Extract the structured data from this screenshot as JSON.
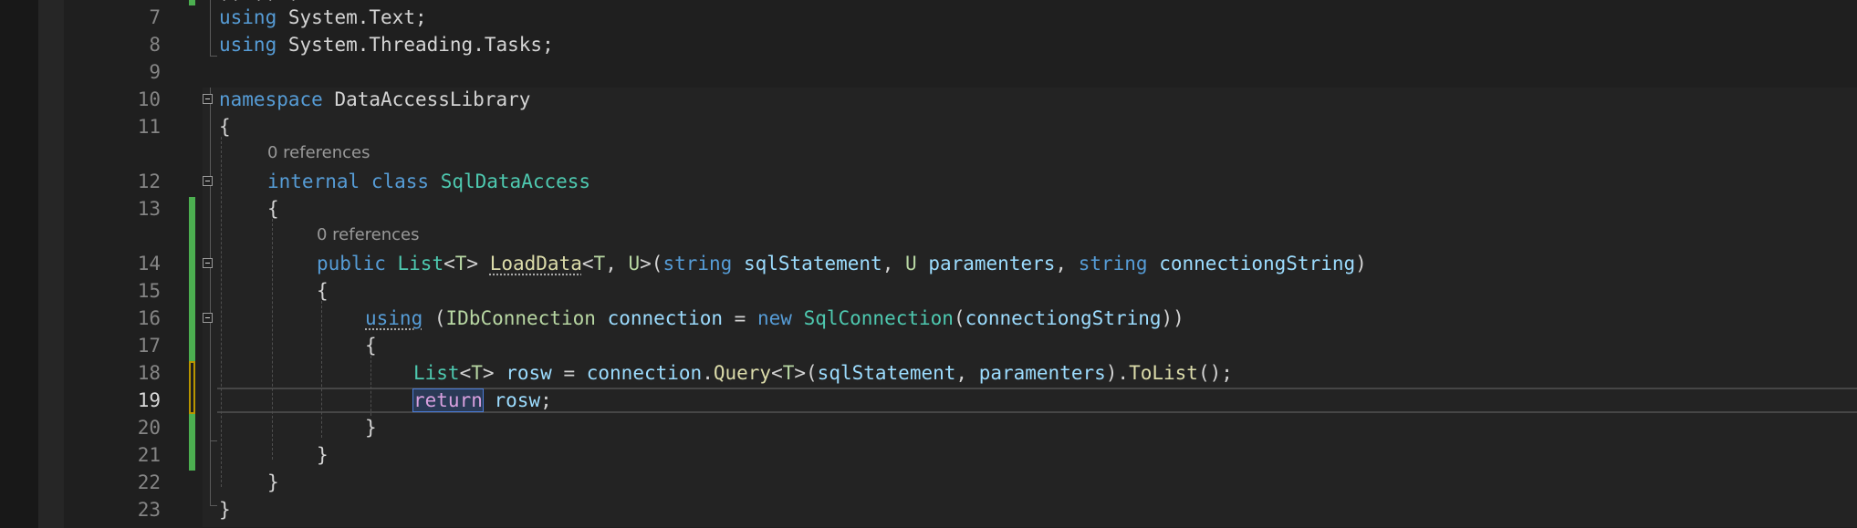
{
  "editor": {
    "lines": [
      {
        "num": "7",
        "tokens": [
          "using",
          "System",
          ".",
          "Text",
          ";"
        ]
      },
      {
        "num": "8",
        "tokens": [
          "using",
          "System",
          ".",
          "Threading",
          ".",
          "Tasks",
          ";"
        ]
      },
      {
        "num": "9",
        "tokens": []
      },
      {
        "num": "10",
        "tokens": [
          "namespace",
          "DataAccessLibrary"
        ]
      },
      {
        "num": "11",
        "tokens": [
          "{"
        ]
      },
      {
        "num": "12",
        "codelens": "0 references",
        "tokens": [
          "internal",
          "class",
          "SqlDataAccess"
        ]
      },
      {
        "num": "13",
        "tokens": [
          "{"
        ]
      },
      {
        "num": "14",
        "codelens": "0 references",
        "tokens": [
          "public",
          "List",
          "<",
          "T",
          ">",
          "LoadData",
          "<",
          "T",
          ",",
          "U",
          ">(",
          "string",
          "sqlStatement",
          ",",
          "U",
          "paramenters",
          ",",
          "string",
          "connectiongString",
          ")"
        ]
      },
      {
        "num": "15",
        "tokens": [
          "{"
        ]
      },
      {
        "num": "16",
        "tokens": [
          "using",
          "(",
          "IDbConnection",
          "connection",
          "=",
          "new",
          "SqlConnection",
          "(",
          "connectiongString",
          "))"
        ]
      },
      {
        "num": "17",
        "tokens": [
          "{"
        ]
      },
      {
        "num": "18",
        "tokens": [
          "List",
          "<",
          "T",
          ">",
          "rosw",
          "=",
          "connection",
          ".",
          "Query",
          "<",
          "T",
          ">(",
          "sqlStatement",
          ",",
          "paramenters",
          ").",
          "ToList",
          "();"
        ]
      },
      {
        "num": "19",
        "tokens": [
          "return",
          "rosw",
          ";"
        ]
      },
      {
        "num": "20",
        "tokens": [
          "}"
        ]
      },
      {
        "num": "21",
        "tokens": [
          "}"
        ]
      },
      {
        "num": "22",
        "tokens": [
          "}"
        ]
      },
      {
        "num": "23",
        "tokens": [
          "}"
        ]
      }
    ],
    "active_line": "19",
    "colors": {
      "keyword": "#569cd6",
      "control_keyword": "#d8a0df",
      "type": "#4ec9b0",
      "type_param": "#b8d7a3",
      "method": "#dcdcaa",
      "variable": "#9cdcfe",
      "text": "#d4d4d4",
      "line_number": "#858585",
      "background": "#1f1f1f",
      "change_added": "#4caf50",
      "change_unsaved": "#b89500"
    }
  }
}
